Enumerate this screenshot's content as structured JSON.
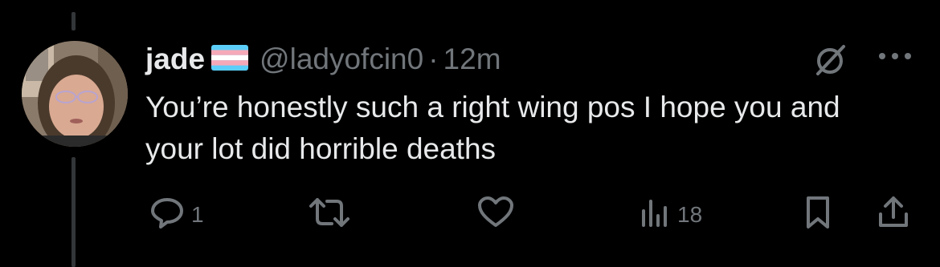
{
  "post": {
    "display_name": "jade",
    "handle": "@ladyofcin0",
    "separator": "·",
    "time": "12m",
    "text": "You’re honestly such a right wing pos I hope you and your lot did horrible deaths"
  },
  "actions": {
    "reply": {
      "icon": "comment-icon",
      "count": "1"
    },
    "retweet": {
      "icon": "retweet-icon",
      "count": ""
    },
    "like": {
      "icon": "heart-icon",
      "count": ""
    },
    "views": {
      "icon": "views-icon",
      "count": "18"
    },
    "bookmark": {
      "icon": "bookmark-icon"
    },
    "share": {
      "icon": "share-icon"
    }
  },
  "icons": {
    "grok": "grok-slash-circle-icon",
    "more": "more-dots-icon",
    "flag": "trans-flag-icon"
  },
  "colors": {
    "background": "#000000",
    "primary_text": "#e7e9ea",
    "secondary_text": "#71767b",
    "thread_line": "#333639",
    "flag_blue": "#5BCEFA",
    "flag_pink": "#F5A9B8",
    "flag_white": "#FFFFFF"
  }
}
